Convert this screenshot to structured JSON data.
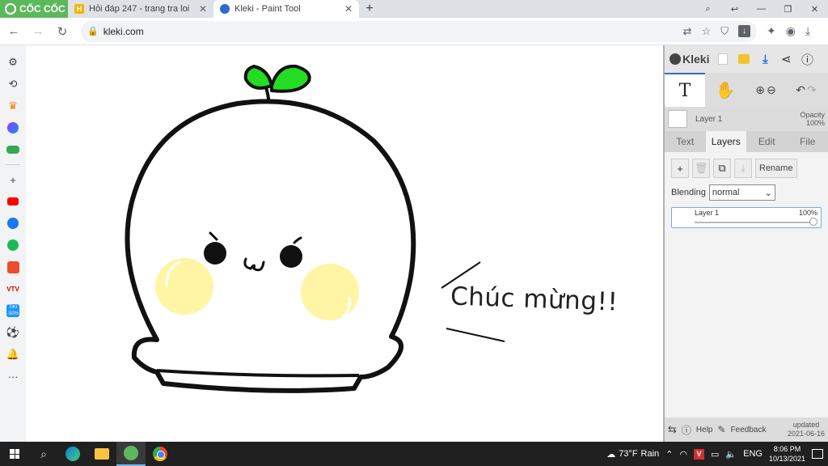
{
  "browser": {
    "brand": "CỐC CỐC",
    "tabs": [
      {
        "title": "Hỏi đáp 247 - trang tra loi",
        "favicon": "hoidap-favicon",
        "active": false
      },
      {
        "title": "Kleki - Paint Tool",
        "favicon": "kleki-favicon",
        "active": true
      }
    ],
    "new_tab": "+",
    "url": "kleki.com"
  },
  "canvas": {
    "speech_text": "Chúc mừng!!",
    "colors": {
      "outline": "#111111",
      "leaf": "#22dd22",
      "cheek": "#fff5a5",
      "body": "#ffffff"
    }
  },
  "kleki": {
    "logo_text": "Kleki",
    "tool_text": "T",
    "current_layer": "Layer 1",
    "opacity_label": "Opacity",
    "opacity_value": "100%",
    "tabs": [
      "Text",
      "Layers",
      "Edit",
      "File"
    ],
    "active_tab": "Layers",
    "rename_label": "Rename",
    "blending_label": "Blending",
    "blending_value": "normal",
    "layers": [
      {
        "name": "Layer 1",
        "opacity": "100%"
      }
    ],
    "help_label": "Help",
    "feedback_label": "Feedback",
    "updated_label": "updated",
    "updated_date": "2021-06-16"
  },
  "taskbar": {
    "weather_temp": "73°F",
    "weather_text": "Rain",
    "lang": "ENG",
    "time": "8:06 PM",
    "date": "10/13/2021"
  }
}
